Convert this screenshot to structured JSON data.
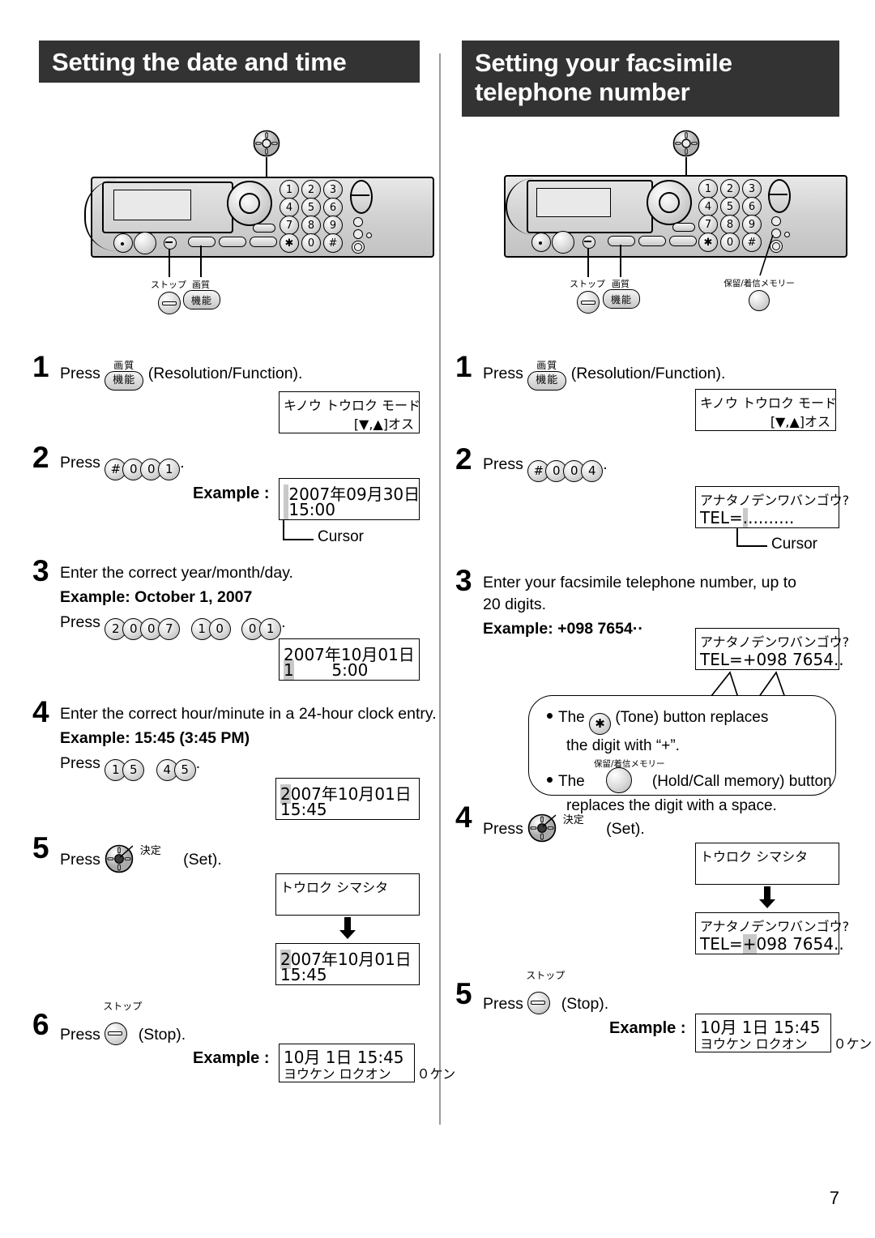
{
  "page": {
    "number": "7"
  },
  "sections": [
    {
      "id": "date-time",
      "title": "Setting the date and time",
      "machine": {
        "keys": [
          "1",
          "2",
          "3",
          "4",
          "5",
          "6",
          "7",
          "8",
          "9",
          "✳",
          "0",
          "#"
        ],
        "labels": {
          "stop": "ストップ",
          "quality": "画質",
          "function": "機能"
        }
      },
      "steps": [
        {
          "num": "1",
          "pre": "Press",
          "button": {
            "jp_above": "画質",
            "jp": "機能"
          },
          "post": "(Resolution/Function).",
          "lcd": {
            "line1": "キノウ トウロク モード",
            "line2_right": "[▼,▲]オス"
          }
        },
        {
          "num": "2",
          "pre": "Press",
          "keys": [
            "#",
            "0",
            "0",
            "1"
          ],
          "post": ".",
          "example_label": "Example :",
          "lcd": {
            "line1": "2007年09月30日",
            "line2": "15:00",
            "cursor_on": "line2"
          },
          "cursor_label": "Cursor"
        },
        {
          "num": "3",
          "text": "Enter the correct year/month/day.",
          "example_title": "Example: October 1, 2007",
          "pre": "Press",
          "key_groups": [
            [
              "2",
              "0",
              "0",
              "7"
            ],
            [
              "1",
              "0"
            ],
            [
              "0",
              "1"
            ]
          ],
          "post": ".",
          "lcd": {
            "line1": "2007年10月01日",
            "line2": "15:00",
            "cursor_on": "line2"
          }
        },
        {
          "num": "4",
          "text": "Enter the correct hour/minute in a 24-hour clock entry.",
          "example_title": "Example: 15:45 (3:45 PM)",
          "pre": "Press",
          "key_groups": [
            [
              "1",
              "5"
            ],
            [
              "4",
              "5"
            ]
          ],
          "post": ".",
          "lcd": {
            "line1": "2007年10月01日",
            "line2": "15:45",
            "cursor_on": "line1"
          }
        },
        {
          "num": "5",
          "pre": "Press",
          "nav": {
            "jp": "決定"
          },
          "post": "(Set).",
          "lcd1": {
            "line1": "トウロク シマシタ",
            "line2": ""
          },
          "lcd2": {
            "line1": "2007年10月01日",
            "line2": "15:45",
            "cursor_on": "line1"
          }
        },
        {
          "num": "6",
          "pre": "Press",
          "stop": {
            "jp_above": "ストップ"
          },
          "post": "(Stop).",
          "example_label": "Example :",
          "lcd": {
            "line1": "10月 1日 15:45",
            "line2": "ヨウケン ロクオン　　０ケン"
          }
        }
      ]
    },
    {
      "id": "fax-number",
      "title_line1": "Setting your facsimile",
      "title_line2": "telephone number",
      "machine": {
        "keys": [
          "1",
          "2",
          "3",
          "4",
          "5",
          "6",
          "7",
          "8",
          "9",
          "✳",
          "0",
          "#"
        ],
        "labels": {
          "stop": "ストップ",
          "quality": "画質",
          "function": "機能",
          "hold": "保留/着信メモリー"
        }
      },
      "steps": [
        {
          "num": "1",
          "pre": "Press",
          "button": {
            "jp_above": "画質",
            "jp": "機能"
          },
          "post": "(Resolution/Function).",
          "lcd": {
            "line1": "キノウ トウロク モード",
            "line2_right": "[▼,▲]オス"
          }
        },
        {
          "num": "2",
          "pre": "Press",
          "keys": [
            "#",
            "0",
            "0",
            "4"
          ],
          "post": ".",
          "lcd": {
            "line1": "アナタノデンワバンゴウ?",
            "line2_prefix": "TEL=",
            "line2_dots": ".........",
            "cursor_on": "line2"
          },
          "cursor_label": "Cursor"
        },
        {
          "num": "3",
          "text_line1": "Enter your facsimile telephone number, up to",
          "text_line2": "20 digits.",
          "example_title": "Example: +098 7654··",
          "lcd": {
            "line1": "アナタノデンワバンゴウ?",
            "line2": "TEL=+098 7654.."
          },
          "note": {
            "line1_a": "The",
            "tone_label": "(Tone) button replaces",
            "line1_b": "the digit with “+”.",
            "line2_jp": "保留/着信メモリー",
            "line2_a": "The",
            "line2_b": "(Hold/Call memory) button",
            "line2_c": "replaces the digit with a space."
          }
        },
        {
          "num": "4",
          "pre": "Press",
          "nav": {
            "jp": "決定"
          },
          "post": "(Set).",
          "lcd1": {
            "line1": "トウロク シマシタ",
            "line2": ""
          },
          "lcd2": {
            "line1": "アナタノデンワバンゴウ?",
            "line2_prefix": "TEL=",
            "line2_rest": "+098 7654..",
            "cursor_on": "line2"
          }
        },
        {
          "num": "5",
          "pre": "Press",
          "stop": {
            "jp_above": "ストップ"
          },
          "post": "(Stop).",
          "example_label": "Example :",
          "lcd": {
            "line1": "10月 1日 15:45",
            "line2": "ヨウケン ロクオン　　０ケン"
          }
        }
      ]
    }
  ]
}
